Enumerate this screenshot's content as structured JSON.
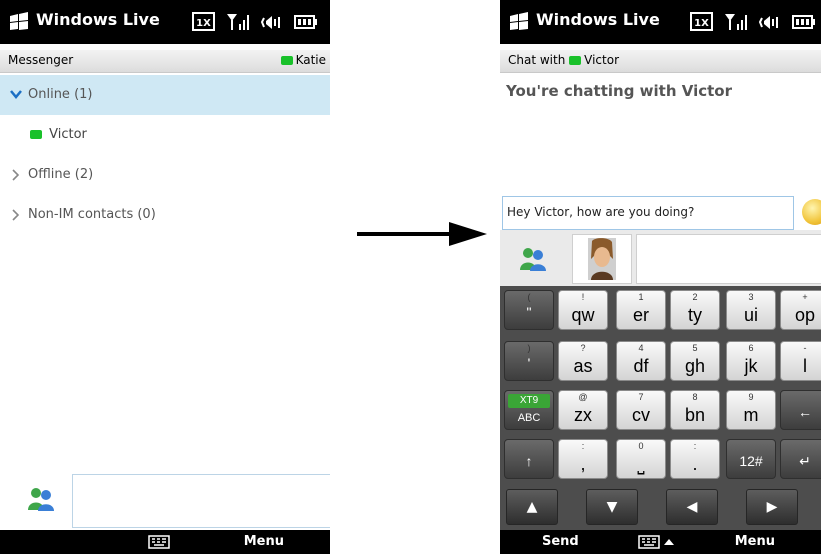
{
  "left": {
    "status": {
      "title": "Windows Live",
      "network": "1X"
    },
    "subheader": {
      "label": "Messenger",
      "user": "Katie"
    },
    "groups": [
      {
        "label": "Online (1)",
        "expanded": true
      },
      {
        "contact": "Victor"
      },
      {
        "label": "Offline (2)",
        "expanded": false
      },
      {
        "label": "Non-IM contacts (0)",
        "expanded": false
      }
    ],
    "softkeys": {
      "right": "Menu"
    }
  },
  "right": {
    "status": {
      "title": "Windows Live",
      "network": "1X"
    },
    "subheader": {
      "prefix": "Chat with",
      "contact": "Victor"
    },
    "chat_title": "You're chatting with Victor",
    "message_input": "Hey Victor, how are you doing?",
    "keyboard": {
      "row1": [
        {
          "sm": "(",
          "big": "\""
        },
        {
          "sm": "!",
          "big": "qw"
        },
        {
          "sm": "1",
          "big": "er"
        },
        {
          "sm": "2",
          "big": "ty"
        },
        {
          "sm": "3",
          "big": "ui"
        },
        {
          "sm": "+",
          "big": "op"
        }
      ],
      "row2": [
        {
          "sm": ")",
          "big": "'"
        },
        {
          "sm": "?",
          "big": "as"
        },
        {
          "sm": "4",
          "big": "df"
        },
        {
          "sm": "5",
          "big": "gh"
        },
        {
          "sm": "6",
          "big": "jk"
        },
        {
          "sm": "-",
          "big": "l"
        }
      ],
      "row3": [
        {
          "xt9a": "XT9",
          "xt9b": "ABC"
        },
        {
          "sm": "@",
          "big": "zx"
        },
        {
          "sm": "7",
          "big": "cv"
        },
        {
          "sm": "8",
          "big": "bn"
        },
        {
          "sm": "9",
          "big": "m"
        },
        {
          "big": "←"
        }
      ],
      "row4": [
        {
          "big": "↑"
        },
        {
          "sm": ":",
          "big": ","
        },
        {
          "sm": "0",
          "big": "⎵"
        },
        {
          "sm": ":",
          "big": "."
        },
        {
          "big": "12#"
        },
        {
          "big": "↵"
        }
      ],
      "nav": [
        "▲",
        "▼",
        "◀",
        "▶"
      ]
    },
    "softkeys": {
      "left": "Send",
      "right": "Menu"
    }
  },
  "colors": {
    "online": "#19c12a",
    "selection": "#cfe8f4",
    "statusbar": "#000000"
  }
}
